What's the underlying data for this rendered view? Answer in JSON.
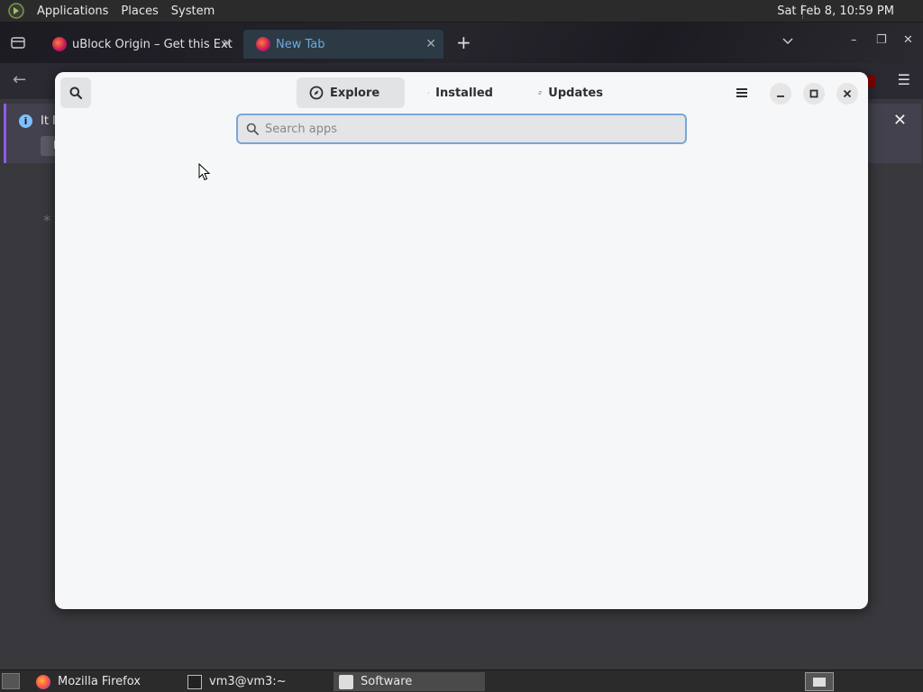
{
  "top_panel": {
    "menus": [
      "Applications",
      "Places",
      "System"
    ],
    "clock": "Sat Feb  8, 10:59 PM"
  },
  "firefox": {
    "tabs": [
      {
        "title": "uBlock Origin – Get this Ext"
      },
      {
        "title": "New Tab"
      }
    ],
    "notice_text": "It lo",
    "notice_button_label": "F"
  },
  "software": {
    "tabs": [
      {
        "label": "Explore",
        "icon": "compass-icon"
      },
      {
        "label": "Installed",
        "icon": "library-icon"
      },
      {
        "label": "Updates",
        "icon": "refresh-icon"
      }
    ],
    "search": {
      "placeholder": "Search apps",
      "value": ""
    }
  },
  "taskbar": {
    "items": [
      {
        "label": "Mozilla Firefox",
        "icon": "firefox-icon"
      },
      {
        "label": "vm3@vm3:~",
        "icon": "terminal-icon"
      },
      {
        "label": "Software",
        "icon": "software-icon"
      }
    ]
  },
  "colors": {
    "panel": "#2b2b2b",
    "window_bg": "#f6f7f8",
    "search_focus": "#7aa6da",
    "firefox_bg": "#38383d"
  }
}
